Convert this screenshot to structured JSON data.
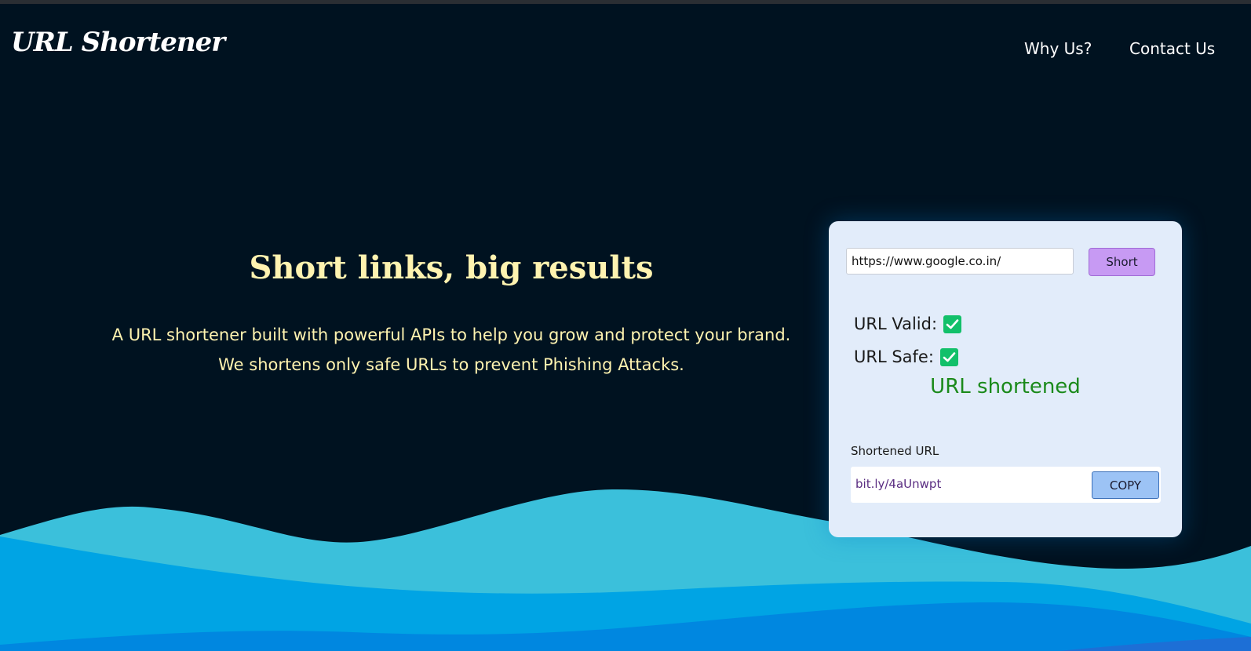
{
  "header": {
    "logo": "URL Shortener",
    "nav": [
      {
        "label": "Why Us?"
      },
      {
        "label": "Contact Us"
      }
    ]
  },
  "hero": {
    "title": "Short links, big results",
    "lines": [
      "A URL shortener built with powerful APIs to help you grow and protect your brand.",
      "We shortens only safe URLs to prevent Phishing Attacks."
    ]
  },
  "card": {
    "url_value": "https://www.google.co.in/",
    "short_label": "Short",
    "checks": [
      {
        "label": "URL Valid:",
        "icon": "checkmark-icon",
        "checked": true
      },
      {
        "label": "URL Safe:",
        "icon": "checkmark-icon",
        "checked": true
      }
    ],
    "status": "URL shortened",
    "result_label": "Shortened URL",
    "result_url": "bit.ly/4aUnwpt",
    "copy_label": "COPY"
  },
  "colors": {
    "background": "#001220",
    "accent_text": "#fff3b0",
    "wave_light": "#3bc0db",
    "wave_mid": "#00a4e4",
    "wave_dark": "#0087e0",
    "success": "#1b8a1b",
    "check": "#12c06a"
  }
}
